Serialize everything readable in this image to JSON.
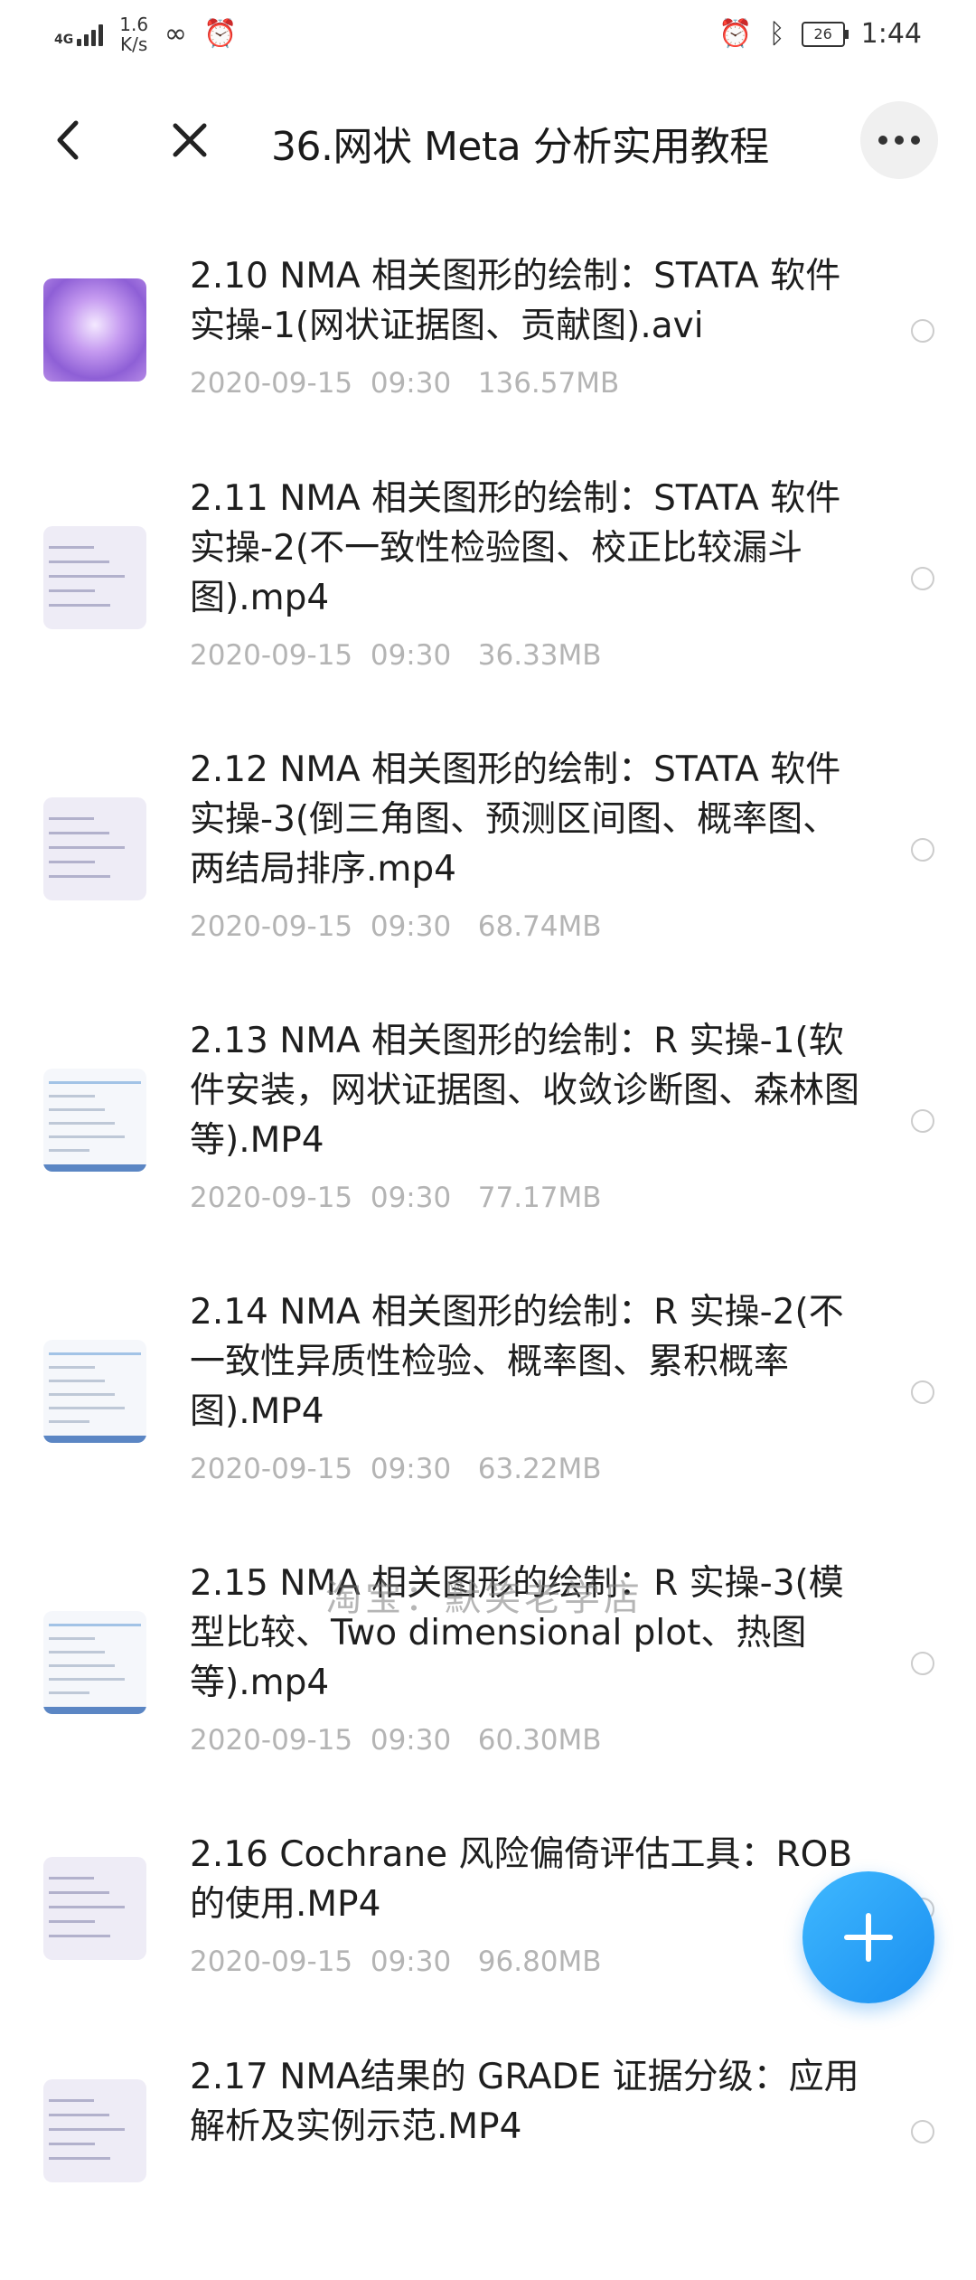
{
  "status_bar": {
    "network": "4G",
    "speed_value": "1.6",
    "speed_unit": "K/s",
    "battery": "26",
    "time": "1:44"
  },
  "header": {
    "title": "36.网状 Meta 分析实用教程"
  },
  "files": [
    {
      "name": "2.10 NMA 相关图形的绘制：STATA 软件实操-1(网状证据图、贡献图).avi",
      "date": "2020-09-15  09:30",
      "size": "136.57MB",
      "thumb": "purple-image"
    },
    {
      "name": "2.11 NMA 相关图形的绘制：STATA 软件实操-2(不一致性检验图、校正比较漏斗图).mp4",
      "date": "2020-09-15  09:30",
      "size": "36.33MB",
      "thumb": "code-screen"
    },
    {
      "name": "2.12 NMA 相关图形的绘制：STATA 软件实操-3(倒三角图、预测区间图、概率图、两结局排序.mp4",
      "date": "2020-09-15  09:30",
      "size": "68.74MB",
      "thumb": "text-screen"
    },
    {
      "name": "2.13 NMA 相关图形的绘制：R 实操-1(软件安装，网状证据图、收敛诊断图、森林图等).MP4",
      "date": "2020-09-15  09:30",
      "size": "77.17MB",
      "thumb": "app-screen"
    },
    {
      "name": "2.14 NMA 相关图形的绘制：R 实操-2(不一致性异质性检验、概率图、累积概率图).MP4",
      "date": "2020-09-15  09:30",
      "size": "63.22MB",
      "thumb": "app-screen"
    },
    {
      "name": "2.15 NMA 相关图形的绘制：R 实操-3(模型比较、Two dimensional plot、热图等).mp4",
      "date": "2020-09-15  09:30",
      "size": "60.30MB",
      "thumb": "app-screen"
    },
    {
      "name": "2.16 Cochrane 风险偏倚评估工具：ROB 的使用.MP4",
      "date": "2020-09-15  09:30",
      "size": "96.80MB",
      "thumb": "text-screen"
    },
    {
      "name": "2.17 NMA结果的 GRADE 证据分级：应用解析及实例示范.MP4",
      "date": "",
      "size": "",
      "thumb": "text-screen"
    }
  ],
  "watermark": "淘宝：默笑老学店",
  "icons": {
    "back": "chevron-left-icon",
    "close": "close-icon",
    "more": "more-dots-icon",
    "fab": "plus-icon"
  },
  "colors": {
    "accent": "#1a8ff0",
    "meta_text": "#b4b4b4"
  }
}
